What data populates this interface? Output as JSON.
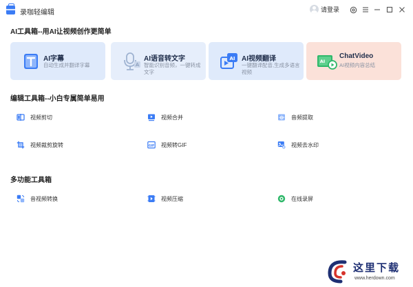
{
  "app": {
    "title": "录咖轻编辑"
  },
  "titlebar": {
    "login_label": "请登录"
  },
  "sections": {
    "ai_tools": "AI工具箱--用AI让视频创作更简单",
    "edit_tools": "编辑工具箱--小白专属简单易用",
    "multi_tools": "多功能工具箱"
  },
  "ai_cards": [
    {
      "title": "AI字幕",
      "desc": "自动生成并翻译字幕",
      "bg": "#dfeafb",
      "icon": "subtitle-icon"
    },
    {
      "title": "AI语音转文字",
      "desc": "智能识别音频，一键转成文字",
      "bg": "#e6eefb",
      "icon": "voice-to-text-icon"
    },
    {
      "title": "AI视频翻译",
      "desc": "一键翻译配音,生成多语言视频",
      "bg": "#dfeafb",
      "icon": "video-translate-icon"
    },
    {
      "title": "ChatVideo",
      "desc": "AI视频内容总结",
      "bg": "#fbe1d9",
      "icon": "chatvideo-icon"
    }
  ],
  "edit_tools": [
    {
      "label": "视频剪切",
      "icon": "video-cut-icon"
    },
    {
      "label": "视频合并",
      "icon": "video-merge-icon"
    },
    {
      "label": "音频提取",
      "icon": "audio-extract-icon"
    },
    {
      "label": "视频裁剪旋转",
      "icon": "crop-rotate-icon"
    },
    {
      "label": "视频转GIF",
      "icon": "gif-icon"
    },
    {
      "label": "视频去水印",
      "icon": "remove-watermark-icon"
    }
  ],
  "multi_tools": [
    {
      "label": "音视频转换",
      "icon": "convert-icon"
    },
    {
      "label": "视频压缩",
      "icon": "compress-icon"
    },
    {
      "label": "在线录屏",
      "icon": "screen-record-icon"
    }
  ],
  "watermark": {
    "text": "这里下载",
    "url": "www.herdown.com"
  },
  "colors": {
    "accent": "#3b7cf5",
    "chatvideo_green": "#2fb86a",
    "text_dark": "#1f2d4a",
    "text_muted": "#8a93a3"
  }
}
